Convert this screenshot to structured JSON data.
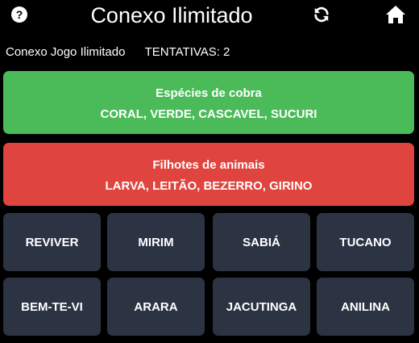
{
  "header": {
    "title": "Conexo Ilimitado",
    "help_icon": "?",
    "icons": [
      "help-icon",
      "refresh-icon",
      "home-icon"
    ]
  },
  "status": {
    "mode_label": "Conexo Jogo Ilimitado",
    "attempts_label": "TENTATIVAS:",
    "attempts_value": "2"
  },
  "solved_groups": [
    {
      "title": "Espécies de cobra",
      "words": "CORAL, VERDE, CASCAVEL, SUCURI",
      "color": "#4bbb5a"
    },
    {
      "title": "Filhotes de animais",
      "words": "LARVA, LEITÃO, BEZERRO, GIRINO",
      "color": "#e0443e"
    }
  ],
  "tiles": [
    "REVIVER",
    "MIRIM",
    "SABIÁ",
    "TUCANO",
    "BEM-TE-VI",
    "ARARA",
    "JACUTINGA",
    "ANILINA"
  ],
  "colors": {
    "background": "#000000",
    "tile": "#2c3444"
  }
}
